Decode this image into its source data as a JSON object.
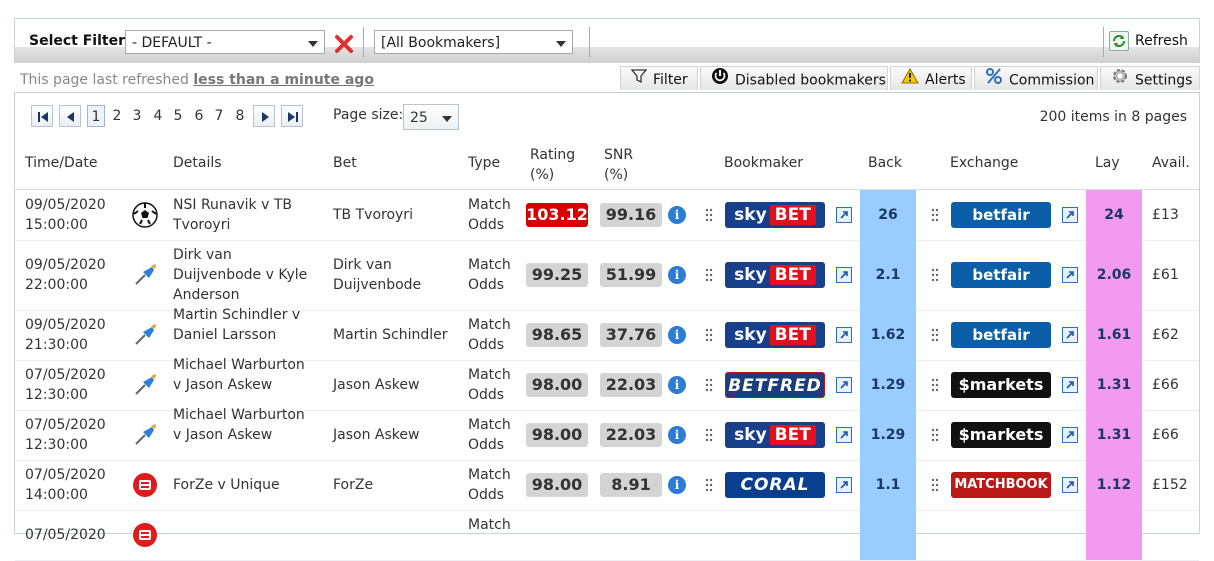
{
  "filter": {
    "label": "Select Filter:",
    "selected": "- DEFAULT -",
    "bookmakers_selected": "[All Bookmakers]",
    "refresh_label": "Refresh"
  },
  "status": {
    "prefix": "This page last refreshed",
    "age": "less than a minute ago"
  },
  "tabs": [
    "Filter",
    "Disabled bookmakers",
    "Alerts",
    "Commission",
    "Settings"
  ],
  "pager": {
    "pages": [
      "1",
      "2",
      "3",
      "4",
      "5",
      "6",
      "7",
      "8"
    ],
    "current": "1",
    "page_size_label": "Page size:",
    "page_size": "25",
    "summary": "200 items in 8 pages"
  },
  "columns": {
    "time": "Time/Date",
    "details": "Details",
    "bet": "Bet",
    "type": "Type",
    "rating": "Rating (%)",
    "snr": "SNR (%)",
    "bookmaker": "Bookmaker",
    "back": "Back",
    "exchange": "Exchange",
    "lay": "Lay",
    "avail": "Avail."
  },
  "rows": [
    {
      "date": "09/05/2020",
      "time": "15:00:00",
      "sport": "soccer-ball-icon",
      "details": "NSI Runavik v TB Tvoroyri",
      "bet": "TB Tvoroyri",
      "type": "Match Odds",
      "rating": "103.12",
      "snr": "99.16",
      "bookmaker": "skybet",
      "back": "26",
      "exchange": "betfair",
      "lay": "24",
      "avail": "£13",
      "hot": true
    },
    {
      "date": "09/05/2020",
      "time": "22:00:00",
      "sport": "dart-icon",
      "details": "Dirk van Duijvenbode v Kyle Anderson",
      "bet": "Dirk van Duijvenbode",
      "type": "Match Odds",
      "rating": "99.25",
      "snr": "51.99",
      "bookmaker": "skybet",
      "back": "2.1",
      "exchange": "betfair",
      "lay": "2.06",
      "avail": "£61",
      "hot": false
    },
    {
      "date": "09/05/2020",
      "time": "21:30:00",
      "sport": "dart-icon",
      "details": "Martin Schindler v Daniel Larsson",
      "bet": "Martin Schindler",
      "type": "Match Odds",
      "rating": "98.65",
      "snr": "37.76",
      "bookmaker": "skybet",
      "back": "1.62",
      "exchange": "betfair",
      "lay": "1.61",
      "avail": "£62",
      "hot": false
    },
    {
      "date": "07/05/2020",
      "time": "12:30:00",
      "sport": "dart-icon",
      "details": "Michael Warburton v Jason Askew",
      "bet": "Jason Askew",
      "type": "Match Odds",
      "rating": "98.00",
      "snr": "22.03",
      "bookmaker": "betfred",
      "back": "1.29",
      "exchange": "smarkets",
      "lay": "1.31",
      "avail": "£66",
      "hot": false
    },
    {
      "date": "07/05/2020",
      "time": "12:30:00",
      "sport": "dart-icon",
      "details": "Michael Warburton v Jason Askew",
      "bet": "Jason Askew",
      "type": "Match Odds",
      "rating": "98.00",
      "snr": "22.03",
      "bookmaker": "skybet",
      "back": "1.29",
      "exchange": "smarkets",
      "lay": "1.31",
      "avail": "£66",
      "hot": false
    },
    {
      "date": "07/05/2020",
      "time": "14:00:00",
      "sport": "esports-icon",
      "details": "ForZe v Unique",
      "bet": "ForZe",
      "type": "Match Odds",
      "rating": "98.00",
      "snr": "8.91",
      "bookmaker": "coral",
      "back": "1.1",
      "exchange": "matchbook",
      "lay": "1.12",
      "avail": "£152",
      "hot": false
    },
    {
      "date": "07/05/2020",
      "time": "",
      "sport": "esports-icon",
      "details": "",
      "bet": "",
      "type": "Match",
      "rating": "",
      "snr": "",
      "bookmaker": "",
      "back": "",
      "exchange": "",
      "lay": "",
      "avail": "",
      "hot": false
    }
  ],
  "logos": {
    "skybet": {
      "a": "sky",
      "b": "BET"
    },
    "betfred": "BETFRED",
    "coral": "CORAL",
    "betfair": "betfair",
    "smarkets": "$markets",
    "matchbook": "MATCHBOOK"
  }
}
